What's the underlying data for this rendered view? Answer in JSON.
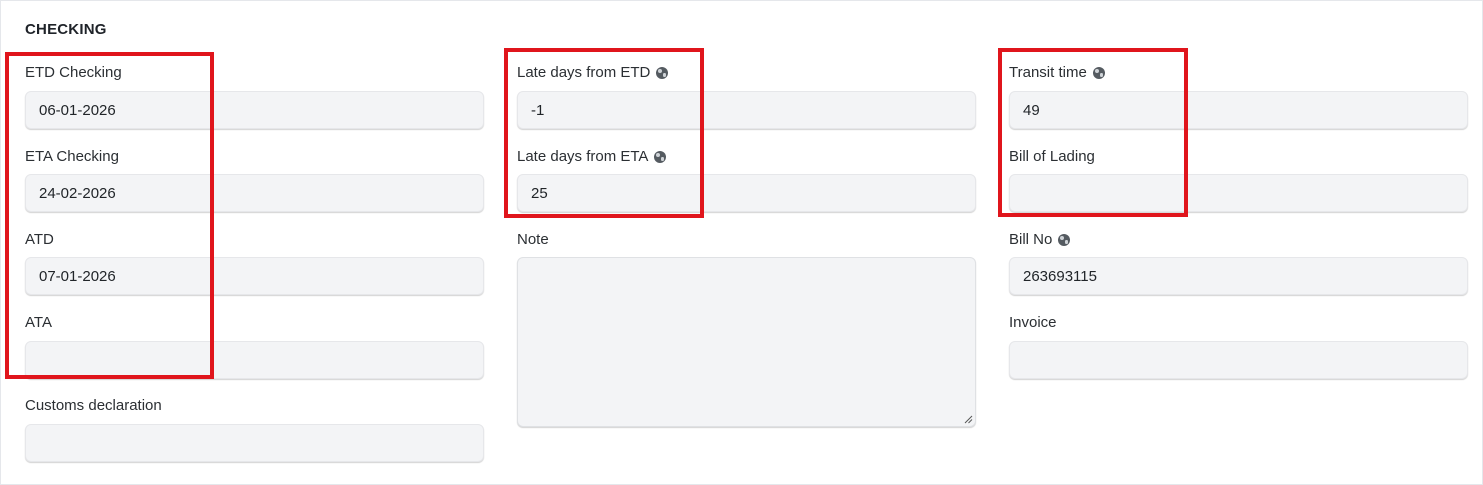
{
  "section": {
    "title": "CHECKING"
  },
  "col1": {
    "etd_checking": {
      "label": "ETD Checking",
      "value": "06-01-2026"
    },
    "eta_checking": {
      "label": "ETA Checking",
      "value": "24-02-2026"
    },
    "atd": {
      "label": "ATD",
      "value": "07-01-2026"
    },
    "ata": {
      "label": "ATA",
      "value": ""
    },
    "customs_declaration": {
      "label": "Customs declaration",
      "value": ""
    }
  },
  "col2": {
    "late_days_etd": {
      "label": "Late days from ETD",
      "value": "-1",
      "icon": "globe-icon"
    },
    "late_days_eta": {
      "label": "Late days from ETA",
      "value": "25",
      "icon": "globe-icon"
    },
    "note": {
      "label": "Note",
      "value": ""
    }
  },
  "col3": {
    "transit_time": {
      "label": "Transit time",
      "value": "49",
      "icon": "globe-icon"
    },
    "bill_of_lading": {
      "label": "Bill of Lading",
      "value": ""
    },
    "bill_no": {
      "label": "Bill No",
      "value": "263693115",
      "icon": "globe-icon"
    },
    "invoice": {
      "label": "Invoice",
      "value": ""
    }
  },
  "colors": {
    "highlight": "#e0151c",
    "input_bg": "#f3f4f6"
  }
}
